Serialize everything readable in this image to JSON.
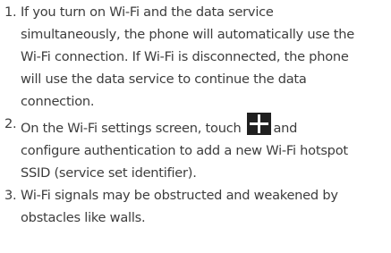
{
  "steps": [
    {
      "number": "1.",
      "lines": [
        "If you turn on Wi-Fi and the data service",
        "simultaneously, the phone will automatically use the",
        "Wi-Fi connection. If Wi-Fi is disconnected, the phone",
        "will use the data service to continue the data",
        "connection."
      ]
    },
    {
      "number": "2.",
      "line1_before_icon": "On the Wi-Fi settings screen, touch",
      "icon": "add-icon",
      "line1_after_icon": "and",
      "lines_rest": [
        "configure authentication to add a new Wi-Fi hotspot",
        "SSID (service set identifier)."
      ]
    },
    {
      "number": "3.",
      "lines": [
        "Wi-Fi signals may be obstructed and weakened by",
        "obstacles like walls."
      ]
    }
  ]
}
